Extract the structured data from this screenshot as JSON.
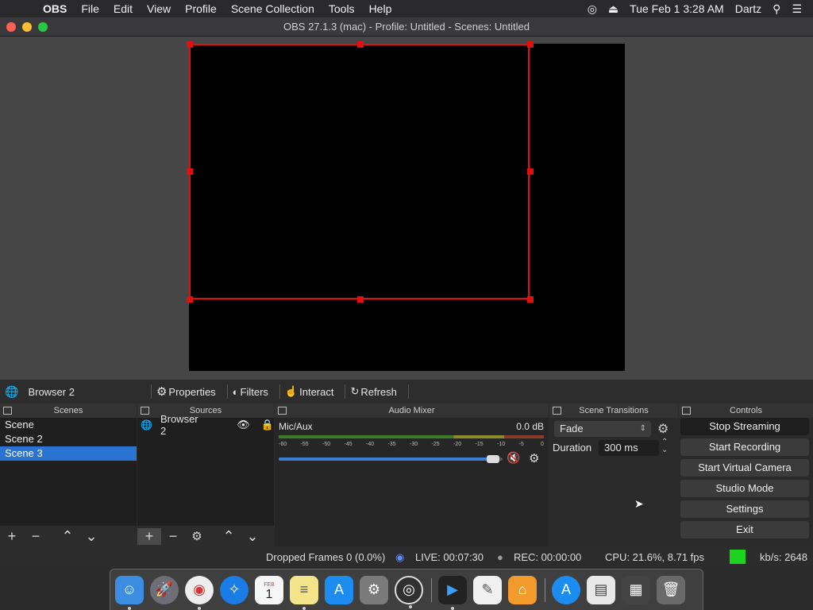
{
  "menubar": {
    "app_name": "OBS",
    "items": [
      "File",
      "Edit",
      "View",
      "Profile",
      "Scene Collection",
      "Tools",
      "Help"
    ],
    "datetime": "Tue Feb 1  3:28 AM",
    "user": "Dartz"
  },
  "window": {
    "title": "OBS 27.1.3 (mac) - Profile: Untitled - Scenes: Untitled"
  },
  "source_toolbar": {
    "selected_source": "Browser 2",
    "properties_label": "Properties",
    "filters_label": "Filters",
    "interact_label": "Interact",
    "refresh_label": "Refresh"
  },
  "scenes": {
    "title": "Scenes",
    "items": [
      "Scene",
      "Scene 2",
      "Scene 3"
    ],
    "selected_index": 2
  },
  "sources": {
    "title": "Sources",
    "items": [
      "Browser 2"
    ]
  },
  "audio_mixer": {
    "title": "Audio Mixer",
    "channel_name": "Mic/Aux",
    "level": "0.0 dB",
    "scale": [
      "-60",
      "-55",
      "-50",
      "-45",
      "-40",
      "-35",
      "-30",
      "-25",
      "-20",
      "-15",
      "-10",
      "-5",
      "0"
    ],
    "volume_fraction": 0.98,
    "muted": true
  },
  "scene_transitions": {
    "title": "Scene Transitions",
    "transition": "Fade",
    "duration_label": "Duration",
    "duration_value": "300 ms"
  },
  "controls": {
    "title": "Controls",
    "buttons": [
      "Stop Streaming",
      "Start Recording",
      "Start Virtual Camera",
      "Studio Mode",
      "Settings",
      "Exit"
    ]
  },
  "statusbar": {
    "dropped": "Dropped Frames 0 (0.0%)",
    "live": "LIVE: 00:07:30",
    "rec": "REC: 00:00:00",
    "cpu": "CPU: 21.6%, 8.71 fps",
    "kbs": "kb/s: 2648",
    "stream_health_color": "#1ed31e"
  },
  "mac_dock": {
    "apps": [
      "finder-icon",
      "launchpad-icon",
      "chrome-icon",
      "safari-icon",
      "calendar-icon",
      "notes-icon",
      "app-store-icon",
      "system-preferences-icon",
      "obs-icon",
      "infuse-icon",
      "textedit-icon",
      "home-icon",
      "app-store-download-icon",
      "document-icon",
      "stack-icon",
      "trash-icon"
    ],
    "calendar_month": "FEB",
    "calendar_day": "1"
  }
}
